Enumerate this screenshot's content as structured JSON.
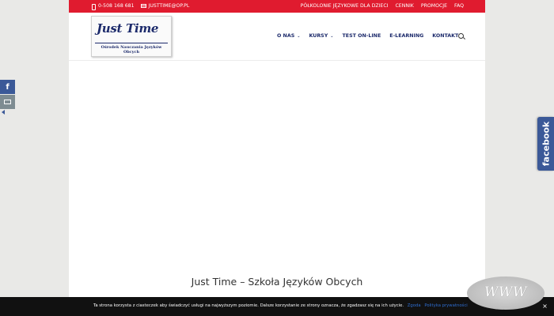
{
  "topbar": {
    "phone": "0-508 168 681",
    "email": "JUSTTIME@OP.PL",
    "links": [
      "PÓŁKOLONIE JĘZYKOWE DLA DZIECI",
      "CENNIK",
      "PROMOCJE",
      "FAQ"
    ]
  },
  "logo": {
    "title": "Just Time",
    "subtitle": "Ośrodek Nauczania Języków Obcych"
  },
  "nav": {
    "items": [
      {
        "label": "O NAS",
        "dropdown": true
      },
      {
        "label": "KURSY",
        "dropdown": true
      },
      {
        "label": "TEST ON-LINE",
        "dropdown": false
      },
      {
        "label": "E-LEARNING",
        "dropdown": false
      },
      {
        "label": "KONTAKT",
        "dropdown": false
      }
    ]
  },
  "main": {
    "headline": "Just Time – Szkoła Języków Obcych"
  },
  "side_tab": {
    "label": "facebook"
  },
  "cookie_bar": {
    "message": "Ta strona korzysta z ciasteczek aby świadczyć usługi na najwyższym poziomie. Dalsze korzystanie ze strony oznacza, że zgadzasz się na ich użycie.",
    "accept_label": "Zgoda",
    "policy_label": "Polityka prywatności",
    "close_label": "×"
  },
  "badge": {
    "text": "WWW"
  },
  "colors": {
    "brand_red": "#e01b2f",
    "brand_navy": "#1c2a6b",
    "facebook_blue": "#3b5998"
  }
}
